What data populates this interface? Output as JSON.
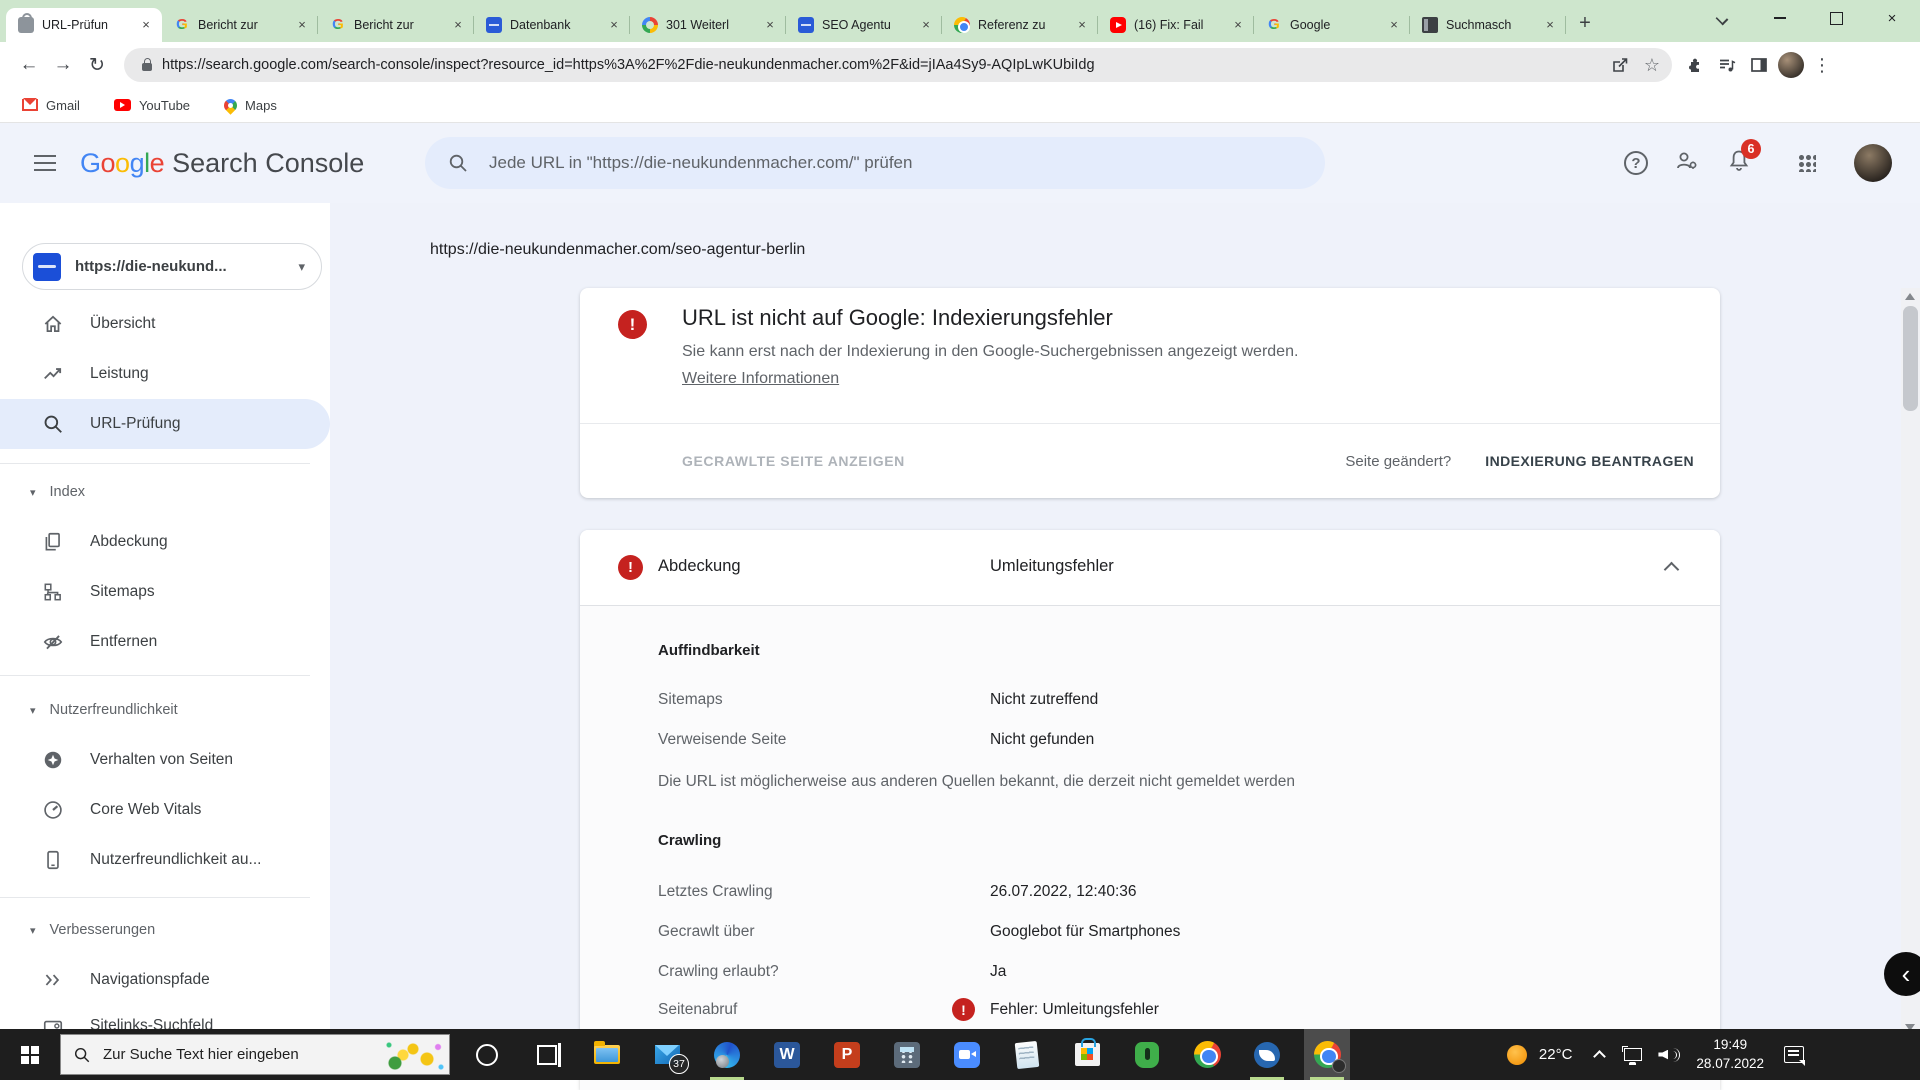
{
  "colors": {
    "accent_blue": "#4285f4",
    "error_red": "#c5221f",
    "badge_red": "#d93025",
    "tabbar_green": "#cee6cd",
    "active_pill": "#e4ecfb",
    "taskbar_bg": "#1e1e1e"
  },
  "icons": {
    "back": "←",
    "forward": "→",
    "reload": "↻",
    "star": "☆",
    "kebab": "⋮",
    "close": "×",
    "plus": "+",
    "caret": "▾",
    "question": "?",
    "exclam": "!",
    "overlay_back": "‹"
  },
  "browser": {
    "tabs": [
      {
        "title": "URL-Prüfun",
        "icon": "search-console-favicon",
        "active": true
      },
      {
        "title": "Bericht zur",
        "icon": "google-g-favicon"
      },
      {
        "title": "Bericht zur",
        "icon": "google-g-favicon"
      },
      {
        "title": "Datenbank",
        "icon": "blue-logo-favicon"
      },
      {
        "title": "301 Weiterl",
        "icon": "color-ring-favicon"
      },
      {
        "title": "SEO Agentu",
        "icon": "blue-logo-favicon"
      },
      {
        "title": "Referenz zu",
        "icon": "chrome-favicon"
      },
      {
        "title": "(16) Fix: Fail",
        "icon": "youtube-favicon"
      },
      {
        "title": "Google",
        "icon": "google-g-favicon"
      },
      {
        "title": "Suchmasch",
        "icon": "dark-page-favicon"
      }
    ],
    "address_url": "https://search.google.com/search-console/inspect?resource_id=https%3A%2F%2Fdie-neukundenmacher.com%2F&id=jIAa4Sy9-AQIpLwKUbiIdg",
    "bookmarks": [
      {
        "label": "Gmail"
      },
      {
        "label": "YouTube"
      },
      {
        "label": "Maps"
      }
    ]
  },
  "header": {
    "logo_letters": [
      {
        "ch": "G"
      },
      {
        "ch": "o"
      },
      {
        "ch": "o"
      },
      {
        "ch": "g"
      },
      {
        "ch": "l"
      },
      {
        "ch": "e"
      }
    ],
    "logo_suffix": "Search Console",
    "search_placeholder": "Jede URL in \"https://die-neukundenmacher.com/\" prüfen",
    "notification_count": "6"
  },
  "sidebar": {
    "property_label": "https://die-neukund...",
    "items": [
      {
        "label": "Übersicht",
        "icon": "home-icon"
      },
      {
        "label": "Leistung",
        "icon": "performance-icon"
      },
      {
        "label": "URL-Prüfung",
        "icon": "url-inspect-icon",
        "active": true
      },
      {
        "label": "Index",
        "type": "section"
      },
      {
        "label": "Abdeckung",
        "icon": "coverage-icon"
      },
      {
        "label": "Sitemaps",
        "icon": "sitemap-icon"
      },
      {
        "label": "Entfernen",
        "icon": "removals-icon"
      },
      {
        "label": "Nutzerfreundlichkeit",
        "type": "section"
      },
      {
        "label": "Verhalten von Seiten",
        "icon": "page-experience-icon"
      },
      {
        "label": "Core Web Vitals",
        "icon": "core-web-vitals-icon"
      },
      {
        "label": "Nutzerfreundlichkeit au...",
        "icon": "mobile-usability-icon"
      },
      {
        "label": "Verbesserungen",
        "type": "section"
      },
      {
        "label": "Navigationspfade",
        "icon": "breadcrumbs-icon"
      },
      {
        "label": "Sitelinks-Suchfeld",
        "icon": "sitelinks-icon"
      }
    ]
  },
  "main": {
    "inspected_url": "https://die-neukundenmacher.com/seo-agentur-berlin",
    "status_card": {
      "title": "URL ist nicht auf Google: Indexierungsfehler",
      "description": "Sie kann erst nach der Indexierung in den Google-Suchergebnissen angezeigt werden.",
      "link_label": "Weitere Informationen",
      "view_crawled_label": "GECRAWLTE SEITE ANZEIGEN",
      "page_changed_label": "Seite geändert?",
      "request_indexing_label": "INDEXIERUNG BEANTRAGEN"
    },
    "coverage_card": {
      "title": "Abdeckung",
      "status": "Umleitungsfehler",
      "discovery_heading": "Auffindbarkeit",
      "discovery_rows": [
        {
          "label": "Sitemaps",
          "value": "Nicht zutreffend"
        },
        {
          "label": "Verweisende Seite",
          "value": "Nicht gefunden"
        }
      ],
      "discovery_note": "Die URL ist möglicherweise aus anderen Quellen bekannt, die derzeit nicht gemeldet werden",
      "crawl_heading": "Crawling",
      "crawl_rows": [
        {
          "label": "Letztes Crawling",
          "value": "26.07.2022, 12:40:36"
        },
        {
          "label": "Gecrawlt über",
          "value": "Googlebot für Smartphones"
        },
        {
          "label": "Crawling erlaubt?",
          "value": "Ja"
        },
        {
          "label": "Seitenabruf",
          "value": "Fehler: Umleitungsfehler",
          "error": true
        }
      ]
    }
  },
  "taskbar": {
    "search_placeholder": "Zur Suche Text hier eingeben",
    "mail_badge": "37",
    "icons": [
      "start",
      "taskbar-search",
      "cortana",
      "task-view",
      "file-explorer",
      "mail",
      "edge",
      "word",
      "powerpoint",
      "calculator",
      "zoom-app",
      "notepad",
      "microsoft-store",
      "pia-vpn",
      "chrome",
      "thunderbird",
      "chrome-active"
    ],
    "tray": {
      "temperature": "22°C",
      "time": "19:49",
      "date": "28.07.2022"
    }
  }
}
